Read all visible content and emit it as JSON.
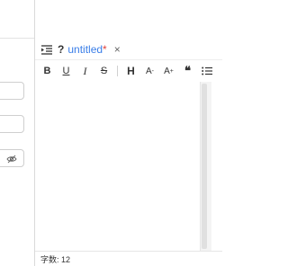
{
  "tab": {
    "help_label": "?",
    "title": "untitled",
    "dirty_marker": "*",
    "close_label": "×"
  },
  "toolbar": {
    "bold": "B",
    "underline": "U",
    "italic": "I",
    "strikethrough": "S",
    "heading": "H",
    "font_size_decrease": "A",
    "font_size_increase": "A",
    "blockquote": "❝"
  },
  "editor": {
    "content": ""
  },
  "status": {
    "word_count": "字数: 12"
  },
  "colors": {
    "title_link": "#3a7ee8",
    "dirty": "#e0433c"
  }
}
